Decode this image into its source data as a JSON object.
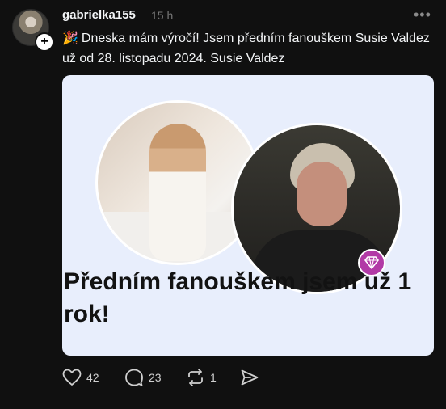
{
  "post": {
    "username": "gabrielka155",
    "time": "15 h",
    "text": "Dneska mám výročí! Jsem předním fanouškem Susie Valdez už od 28. listopadu 2024. Susie Valdez",
    "party_icon": "🎉",
    "more_icon": "•••"
  },
  "card": {
    "title": "Předním fanouškem jsem už 1 rok!",
    "background": "#e8eefc",
    "badge_color": "#b23aa6"
  },
  "actions": {
    "likes": "42",
    "comments": "23",
    "reposts": "1"
  },
  "icons": [
    "heart-icon",
    "comment-icon",
    "repost-icon",
    "share-icon",
    "diamond-icon",
    "plus-icon",
    "more-icon"
  ]
}
